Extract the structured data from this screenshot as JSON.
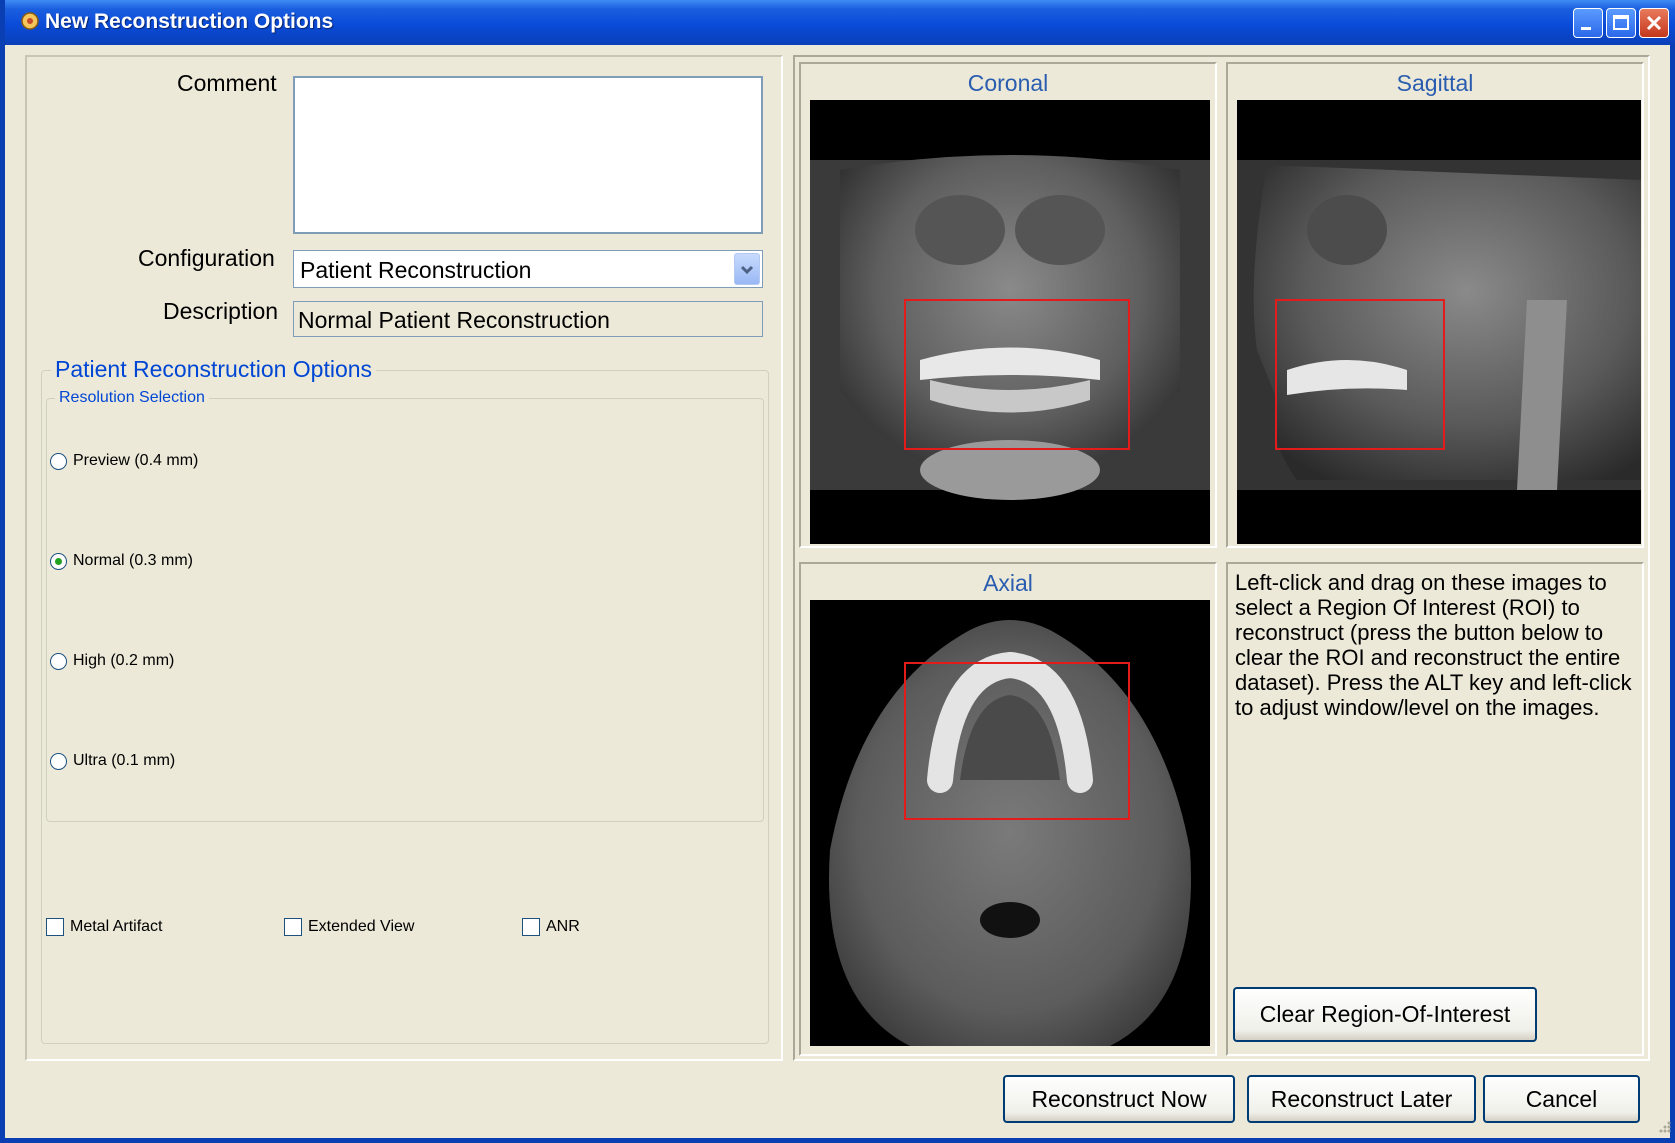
{
  "window": {
    "title": "New Reconstruction Options",
    "title_bar_color": "#0a4bd8",
    "controls": [
      "minimize-icon",
      "maximize-icon",
      "close-icon"
    ]
  },
  "form": {
    "comment_label": "Comment",
    "comment_value": "",
    "configuration_label": "Configuration",
    "configuration_value": "Patient Reconstruction",
    "description_label": "Description",
    "description_value": "Normal Patient Reconstruction"
  },
  "options": {
    "group_title": "Patient Reconstruction Options",
    "resolution": {
      "title": "Resolution Selection",
      "items": [
        {
          "label": "Preview (0.4 mm)",
          "selected": false
        },
        {
          "label": "Normal (0.3 mm)",
          "selected": true
        },
        {
          "label": "High (0.2 mm)",
          "selected": false
        },
        {
          "label": "Ultra (0.1 mm)",
          "selected": false
        }
      ]
    },
    "checkboxes": [
      {
        "label": "Metal Artifact",
        "checked": false
      },
      {
        "label": "Extended View",
        "checked": false
      },
      {
        "label": "ANR",
        "checked": false
      }
    ]
  },
  "views": {
    "coronal": "Coronal",
    "sagittal": "Sagittal",
    "axial": "Axial",
    "roi_color": "#e31b1b"
  },
  "info_text": "Left-click and drag on these images to select a Region Of Interest (ROI) to reconstruct (press the button below to clear the ROI and reconstruct the entire dataset).  Press the ALT key and left-click to adjust window/level on the images.",
  "buttons": {
    "clear_roi": "Clear Region-Of-Interest",
    "reconstruct_now": "Reconstruct Now",
    "reconstruct_later": "Reconstruct Later",
    "cancel": "Cancel"
  }
}
